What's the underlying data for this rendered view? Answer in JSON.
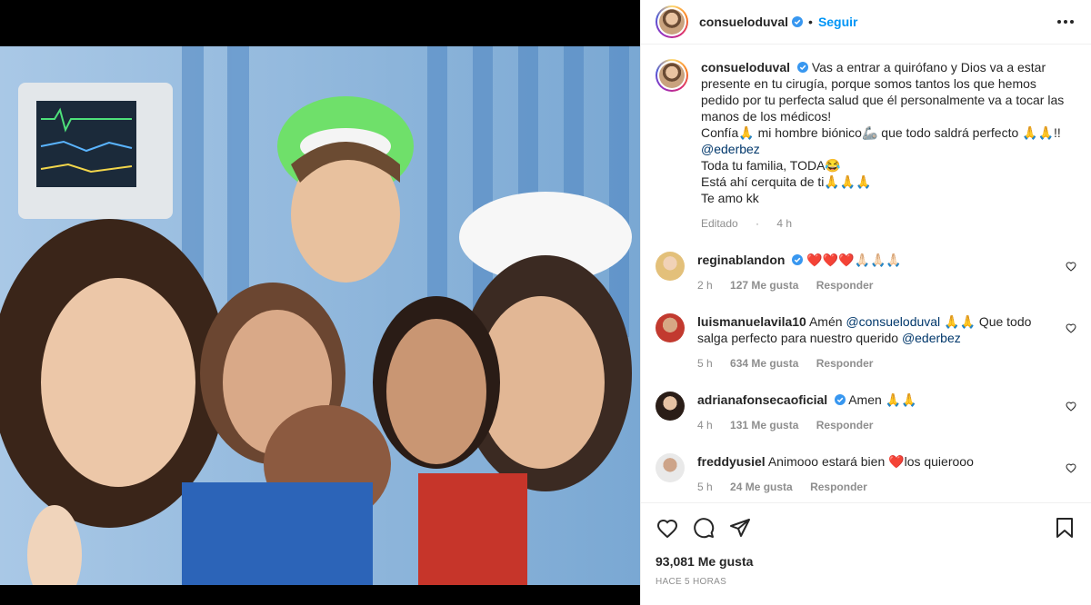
{
  "post": {
    "username": "consueloduval",
    "dot": "•",
    "follow_label": "Seguir",
    "caption_lines": [
      "Vas a entrar a quirófano y Dios va a estar",
      "presente en tu cirugía, porque somos tantos los que hemos",
      "pedido por tu perfecta salud que él personalmente va a tocar las",
      "manos de los médicos!",
      "Confía🙏 mi hombre biónico🦾 que todo saldrá perfecto 🙏🙏!!",
      "@ederbez",
      "Toda tu familia, TODA😂",
      "Está ahí cerquita de ti🙏🙏🙏",
      "Te amo kk"
    ],
    "edited_label": "Editado",
    "edited_sep": "·",
    "edited_time": "4 h",
    "likes": "93,081 Me gusta",
    "time_ago": "HACE 5 HORAS"
  },
  "comments": [
    {
      "user": "reginablandon",
      "verified": true,
      "text": "❤️❤️❤️🙏🏻🙏🏻🙏🏻",
      "time": "2 h",
      "likes": "127 Me gusta",
      "reply": "Responder"
    },
    {
      "user": "luismanuelavila10",
      "verified": false,
      "text_parts": [
        "Amén ",
        "@consueloduval",
        " 🙏🙏 Que todo salga perfecto para nuestro querido ",
        "@ederbez"
      ],
      "time": "5 h",
      "likes": "634 Me gusta",
      "reply": "Responder"
    },
    {
      "user": "adrianafonsecaoficial",
      "verified": true,
      "text": "Amen 🙏🙏",
      "time": "4 h",
      "likes": "131 Me gusta",
      "reply": "Responder"
    },
    {
      "user": "freddyusiel",
      "verified": false,
      "text_parts": [
        "Animooo estará bien ",
        "❤️",
        "los quierooo"
      ],
      "time": "5 h",
      "likes": "24 Me gusta",
      "reply": "Responder"
    }
  ],
  "colors": {
    "accent": "#0095f6",
    "verified": "#3897f0",
    "mention": "#00376b",
    "muted": "#8e8e8e",
    "heart": "#ed4956"
  },
  "icons": [
    "more-options-icon",
    "verified-badge-icon",
    "heart-icon",
    "comment-icon",
    "share-icon",
    "bookmark-icon"
  ]
}
